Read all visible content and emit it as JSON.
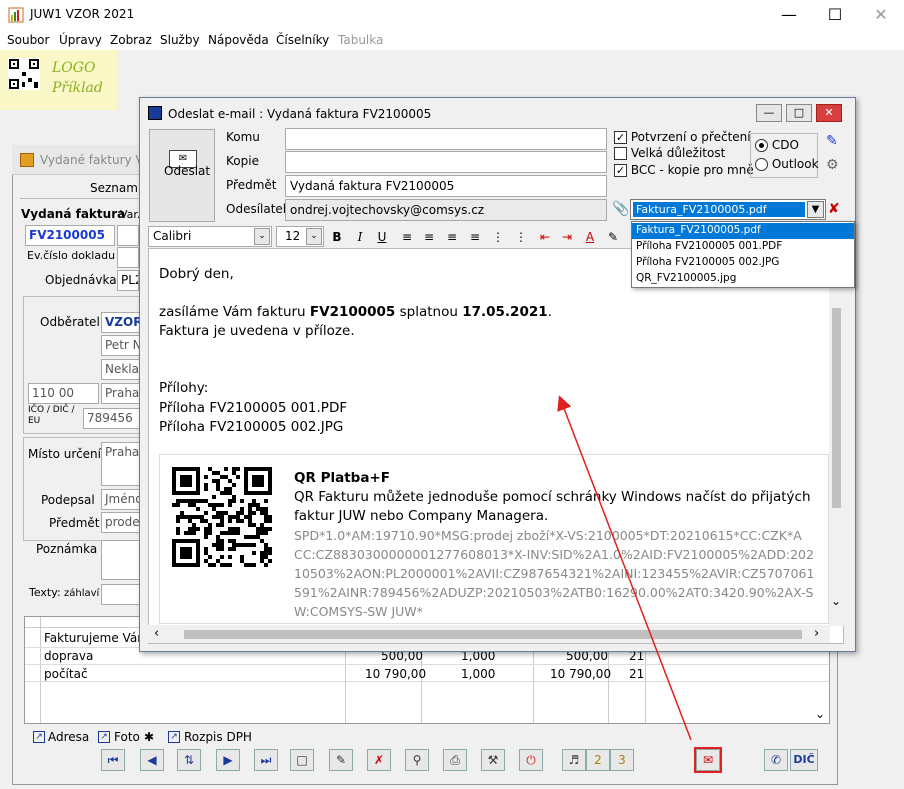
{
  "app": {
    "title": "JUW1 VZOR 2021",
    "logo_line1": "LOGO",
    "logo_line2": "Příklad"
  },
  "menu": [
    "Soubor",
    "Úpravy",
    "Zobraz",
    "Služby",
    "Nápověda",
    "Číselníky",
    "Tabulka"
  ],
  "bg": {
    "window_title": "Vydané faktury VZO",
    "seznam": "Seznam",
    "section_title": "Vydaná faktura",
    "var_label": "Var.",
    "invoice_number": "FV2100005",
    "ev_cislo_label": "Ev.číslo dokladu",
    "objednavka_label": "Objednávka",
    "objednavka_value": "PL2",
    "odberatel_label": "Odběratel",
    "odberatel_value": "VZOR",
    "contact_value": "Petr N",
    "street_value": "Nekla",
    "zip_value": "110 00",
    "city_value": "Praha",
    "ico_label": "IČO / DIČ / EU",
    "ico_value": "789456",
    "misto_label": "Místo určení",
    "misto_value": "Praha",
    "podepsal_label": "Podepsal",
    "podepsal_value": "Jméno",
    "predmet_label": "Předmět",
    "predmet_value": "prode",
    "poznamka_label": "Poznámka",
    "texty_label": "Texty:",
    "zahlavi_label": "záhlaví"
  },
  "grid": {
    "rows": [
      {
        "name": "Fakturujeme Vám",
        "c1": "",
        "c2": "",
        "c3": "",
        "c4": ""
      },
      {
        "name": "doprava",
        "c1": "500,00",
        "c2": "1,000",
        "c3": "500,00",
        "c4": "21"
      },
      {
        "name": "počítač",
        "c1": "10 790,00",
        "c2": "1,000",
        "c3": "10 790,00",
        "c4": "21"
      }
    ]
  },
  "bottom_tabs": [
    "Adresa",
    "Foto",
    "Rozpis DPH"
  ],
  "email": {
    "dialog_title": "Odeslat e-mail : Vydaná faktura FV2100005",
    "send_label": "Odeslat",
    "komu_label": "Komu",
    "komu_value": "",
    "kopie_label": "Kopie",
    "kopie_value": "",
    "predmet_label": "Předmět",
    "predmet_value": "Vydaná faktura FV2100005",
    "odesilatel_label": "Odesílatel",
    "odesilatel_value": "ondrej.vojtechovsky@comsys.cz",
    "chk_read_receipt": "Potvrzení o přečtení",
    "chk_high_priority": "Velká důležitost",
    "chk_bcc": "BCC - kopie pro mně",
    "radio_cdo": "CDO",
    "radio_outlook": "Outlook",
    "attachment_selected": "Faktura_FV2100005.pdf",
    "attachments": [
      "Faktura_FV2100005.pdf",
      "Příloha FV2100005 001.PDF",
      "Příloha FV2100005 002.JPG",
      "QR_FV2100005.jpg"
    ],
    "font_name": "Calibri",
    "font_size": "12"
  },
  "body": {
    "greeting": "Dobrý den,",
    "line1_a": "zasíláme Vám fakturu ",
    "line1_b": "FV2100005",
    "line1_c": " splatnou ",
    "line1_d": "17.05.2021",
    "line1_e": ".",
    "line2": "Faktura je uvedena v příloze.",
    "attachments_head": "Přílohy:",
    "att1": "Příloha FV2100005 001.PDF",
    "att2": "Příloha FV2100005 002.JPG",
    "qr_title": "QR Platba+F",
    "qr_desc1": "QR Fakturu můžete jednoduše pomocí schránky Windows načíst do přijatých",
    "qr_desc2": "faktur JUW nebo Company Managera.",
    "qr_code_lines": [
      "SPD*1.0*AM:19710.90*MSG:prodej zboží*X-VS:2100005*DT:20210615*CC:CZK*A",
      "CC:CZ8830300000001277608013*X-INV:SID%2A1.0%2AID:FV2100005%2ADD:202",
      "10503%2AON:PL2000001%2AVII:CZ987654321%2AINI:123455%2AVIR:CZ5707061",
      "591%2AINR:789456%2ADUZP:20210503%2ATB0:16290.00%2AT0:3420.90%2AX-S",
      "W:COMSYS-SW JUW*"
    ]
  },
  "toolbar": {
    "dic_label": "DIČ"
  },
  "colors": {
    "accent": "#1a3ad0",
    "highlight_red": "#e02020",
    "selection": "#0078d7"
  }
}
